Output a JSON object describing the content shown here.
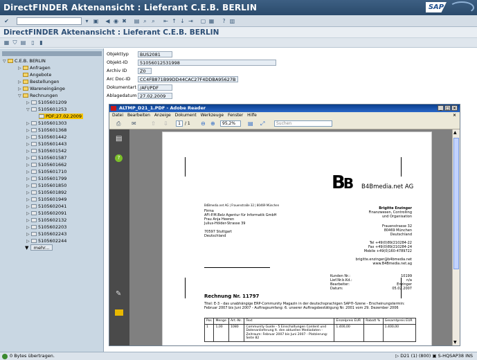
{
  "window": {
    "title": "DirectFINDER Aktenansicht : Lieferant C.E.B. BERLIN",
    "brand": "SAP"
  },
  "heading": "DirectFINDER Aktenansicht : Lieferant C.E.B. BERLIN",
  "tree": {
    "root": "C.E.B. BERLIN",
    "folders": [
      "Anfragen",
      "Angebote",
      "Bestellungen",
      "Wareneingänge",
      "Rechnungen"
    ],
    "rechnungen": [
      "5105601209",
      "5105601253",
      "PDF;27.02.2009",
      "5105601303",
      "5105601368",
      "5105601442",
      "5105601443",
      "5105601542",
      "5105601587",
      "5105601662",
      "5105601710",
      "5105601799",
      "5105601850",
      "5105601892",
      "5105601949",
      "5105602041",
      "5105602091",
      "5105602132",
      "5105602203",
      "5105602243",
      "5105602244"
    ],
    "more_label": "mehr..."
  },
  "attributes": [
    {
      "label": "Objekttyp",
      "value": "BUS2081"
    },
    {
      "label": "Objekt-ID",
      "value": "51056012531998"
    },
    {
      "label": "Archiv ID",
      "value": "Z0"
    },
    {
      "label": "Arc Doc-ID",
      "value": "CC4FB871B99DD44CAC27F4DDBA95627B"
    },
    {
      "label": "Dokumentart",
      "value": "/AFI/PDF"
    },
    {
      "label": "Ablagedatum",
      "value": "27.02.2009"
    }
  ],
  "adobe": {
    "title": "ALTMP_D21_1.PDF - Adobe Reader",
    "menu": [
      "Datei",
      "Bearbeiten",
      "Anzeige",
      "Dokument",
      "Werkzeuge",
      "Fenster",
      "Hilfe"
    ],
    "page_current": "1",
    "page_total": "/ 1",
    "zoom": "95,2%",
    "search_placeholder": "Suchen"
  },
  "pdf": {
    "company": "B4Bmedia.net AG",
    "sender_line": "B4Bmedia.net AG | Frauenstraße 32 | 80469 München",
    "address": [
      "Firma",
      "AFI-P.M.Belz Agentur für Informatik GmbH",
      "Frau Anja Heeren",
      "Julius-Hölder-Strasse 39",
      "",
      "70597 Stuttgart",
      "Deutschland"
    ],
    "contact": [
      "Brigitte Enzinger",
      "Finanzwesen, Controlling",
      "und Organisation",
      "",
      "Frauenstrasse 32",
      "80469 München",
      "Deutschland",
      "",
      "Tel +49(0)89/210284-22",
      "Fax +49(0)89/210284-24",
      "Mobile +49(0)160-4789722",
      "",
      "brigitte.enzinger@b4bmedia.net",
      "www.B4Bmedia.net.ag"
    ],
    "meta_labels": [
      "Kunden Nr.:",
      "Lief.Nr.b.Kd.:",
      "Bearbeiter:",
      "Datum:"
    ],
    "meta_values": [
      "10199",
      "n/a",
      "Enzinger",
      "05.02.2007"
    ],
    "invoice_title": "Rechnung Nr. 11797",
    "subject": "Titel: E-3 - das unabhängige ERP-Community Magazin in der deutschsprachigen SAP®-Szene - Erscheinungstermin: Februar 2007 bis Juni 2007 - Auftragsumfang: 6. unserer Auftragsbestätigung Nr. 2001 vom 29. Dezember 2006",
    "table_headers": [
      "Pos",
      "Menge",
      "Art.-Nr.",
      "Text",
      "Einzelpreis EUR",
      "Rabatt %",
      "Gesamtpreis EUR"
    ],
    "row": [
      "1",
      "1,00",
      "1080",
      "Community Guide - 5 Einschaltungen Content und Datenanlieferung lt. den aktuellen Mediadaten - Zeitraum: Februar 2007 bis Juni 2007 - Platzierung: Seite 82",
      "1.400,00",
      "",
      "1.400,00"
    ]
  },
  "status": {
    "message": "0 Bytes übertragen.",
    "system": "D21 (1) (800)",
    "server": "S-HQSAP38",
    "mode": "INS"
  }
}
